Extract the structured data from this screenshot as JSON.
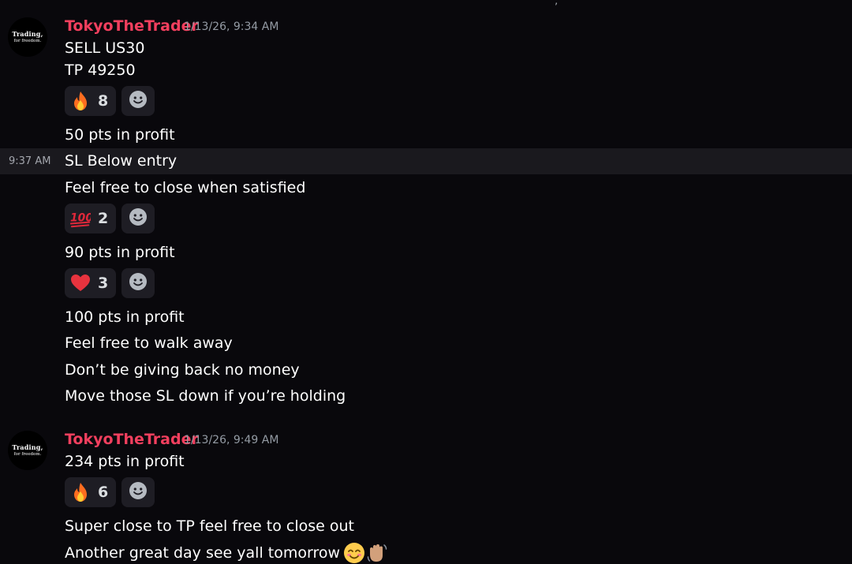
{
  "top_fragment": "',",
  "messages": [
    {
      "author": "TokyoTheTrader",
      "timestamp": "1/13/26, 9:34 AM",
      "avatar": {
        "line1": "Trading,",
        "line2": "for freedom."
      },
      "lines": {
        "l1": "SELL US30",
        "l2": "TP 49250",
        "l3": "50 pts in profit",
        "l4": "SL Below entry",
        "l5": "Feel free to close when satisfied",
        "l6": "90 pts in profit",
        "l7": "100 pts in profit",
        "l8": "Feel free to walk away",
        "l9": "Don’t be giving back no money",
        "l10": "Move those SL down if you’re holding"
      },
      "hover_timestamp": "9:37 AM",
      "reactions": {
        "r1": {
          "emoji": "fire-emoji",
          "count": "8"
        },
        "r2": {
          "emoji": "hundred-points-emoji",
          "count": "2"
        },
        "r3": {
          "emoji": "red-heart-emoji",
          "count": "3"
        }
      }
    },
    {
      "author": "TokyoTheTrader",
      "timestamp": "1/13/26, 9:49 AM",
      "avatar": {
        "line1": "Trading,",
        "line2": "for freedom."
      },
      "lines": {
        "l1": "234 pts in profit",
        "l2": "Super close to TP feel free to close out",
        "l3": "Another great day see yall tomorrow"
      },
      "reactions": {
        "r1": {
          "emoji": "fire-emoji",
          "count": "6"
        }
      }
    }
  ],
  "colors": {
    "background": "#09080c",
    "author": "#f23f5e",
    "reaction_bg": "#1e1d24",
    "hover_row": "#1a191e"
  }
}
